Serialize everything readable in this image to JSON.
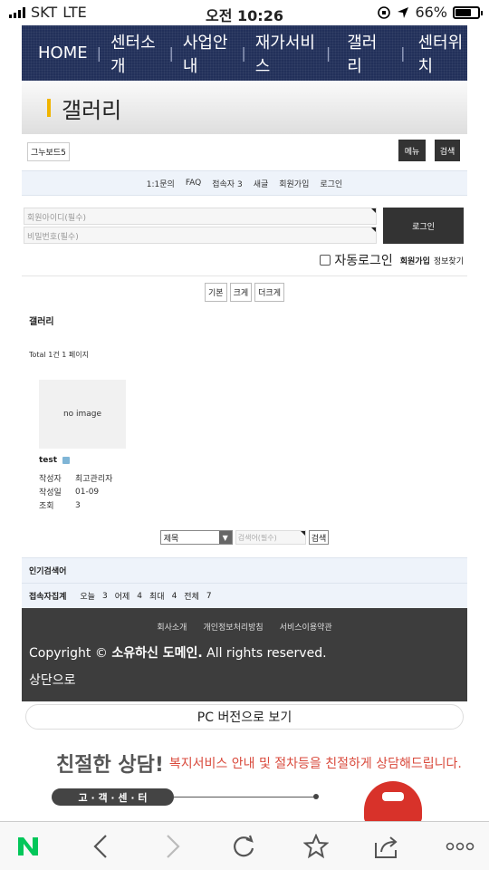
{
  "status_bar": {
    "carrier": "SKT",
    "network": "LTE",
    "time": "오전 10:26",
    "battery": "66%"
  },
  "nav": {
    "items": [
      "HOME",
      "센터소개",
      "사업안내",
      "재가서비스",
      "갤러리",
      "센터위치"
    ]
  },
  "page_title": "갤러리",
  "toolbar": {
    "theme": "그누보드5",
    "menu": "메뉴",
    "search": "검색"
  },
  "links": [
    "1:1문의",
    "FAQ",
    "접속자 3",
    "새글",
    "회원가입",
    "로그인"
  ],
  "login": {
    "id_placeholder": "회원아이디(필수)",
    "pw_placeholder": "비밀번호(필수)",
    "login_button": "로그인",
    "auto_login": "자동로그인",
    "join": "회원가입",
    "find": "정보찾기"
  },
  "font_sizes": [
    "기본",
    "크게",
    "더크게"
  ],
  "board": {
    "title": "갤러리",
    "total": "Total 1건 1 페이지",
    "no_image": "no image",
    "post": {
      "subject": "test",
      "author_label": "작성자",
      "author": "최고관리자",
      "date_label": "작성일",
      "date": "01-09",
      "views_label": "조회",
      "views": "3"
    }
  },
  "search": {
    "field": "제목",
    "placeholder": "검색어(필수)",
    "button": "검색"
  },
  "popular": "인기검색어",
  "visitors": {
    "label": "접속자집계",
    "today_label": "오늘",
    "today": "3",
    "yesterday_label": "어제",
    "yesterday": "4",
    "max_label": "최대",
    "max": "4",
    "total_label": "전체",
    "total": "7"
  },
  "footer": {
    "links": [
      "회사소개",
      "개인정보처리방침",
      "서비스이용약관"
    ],
    "copyright_prefix": "Copyright ©",
    "company": "소유하신 도메인.",
    "copyright_suffix": "All rights reserved.",
    "to_top": "상단으로"
  },
  "pc_view": "PC 버전으로 보기",
  "consult": {
    "headline": "친절한 상담!",
    "sub": "복지서비스 안내 및 절차등을 친절하게 상담해드립니다.",
    "center": "고 · 객 · 센 · 터"
  },
  "colors": {
    "nav_bg": "#22305a",
    "accent": "#f0b400",
    "footer_bg": "#3d3d3d",
    "naver": "#03c75a",
    "consult_red": "#d94a3c"
  }
}
